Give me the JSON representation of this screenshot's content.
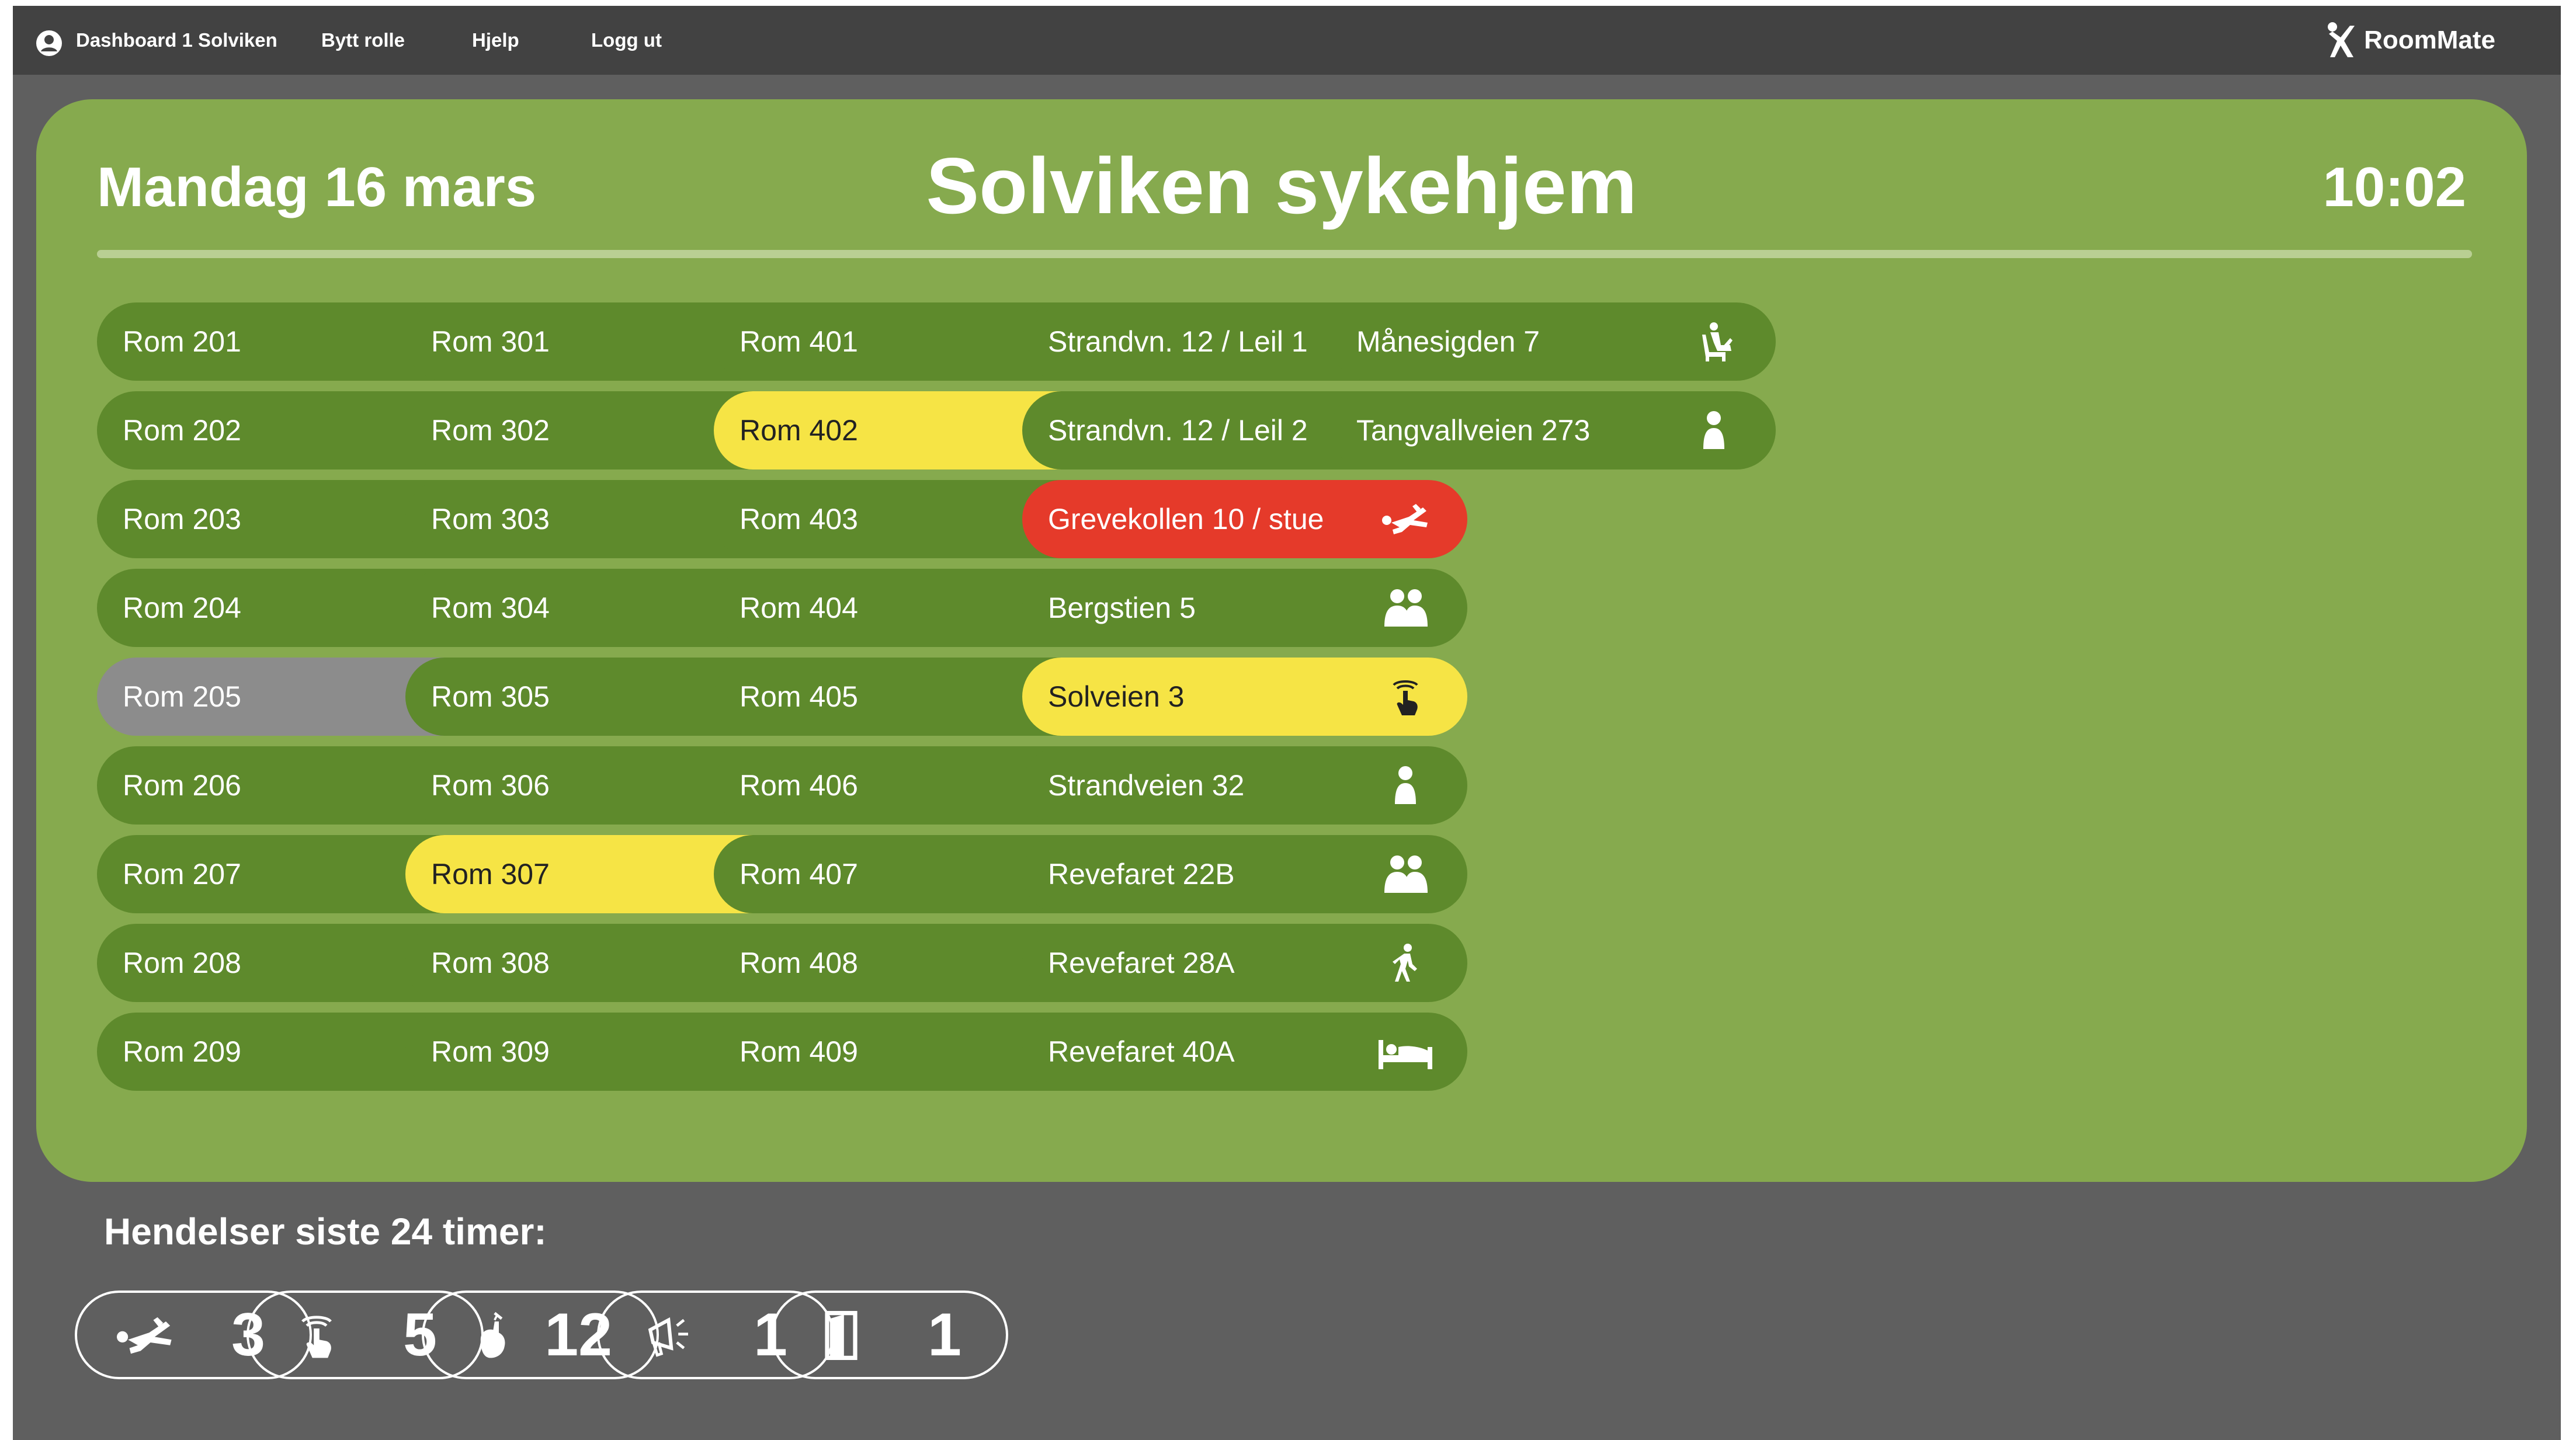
{
  "nav": {
    "user_label": "Dashboard 1 Solviken",
    "switch_role": "Bytt rolle",
    "help": "Hjelp",
    "logout": "Logg ut",
    "brand": "RoomMate"
  },
  "header": {
    "date": "Mandag 16 mars",
    "title": "Solviken sykehjem",
    "time": "10:02"
  },
  "colors": {
    "panel": "#86aa4e",
    "room_default": "#5e8a2c",
    "alert_yellow": "#f6e445",
    "alert_red": "#e53a2a",
    "offline_grey": "#8c8c8c",
    "background": "#5f5f5f",
    "topbar": "#424242"
  },
  "columns": [
    [
      {
        "label": "Rom 201",
        "icon": "person-icon",
        "status": "normal"
      },
      {
        "label": "Rom 202",
        "icon": "bed-icon",
        "status": "normal"
      },
      {
        "label": "Rom 203",
        "icon": "chair-icon",
        "status": "normal"
      },
      {
        "label": "Rom 204",
        "icon": "bed-icon",
        "status": "normal"
      },
      {
        "label": "Rom 205",
        "icon": "unplugged-icon",
        "status": "offline"
      },
      {
        "label": "Rom 206",
        "icon": "person-icon",
        "status": "normal"
      },
      {
        "label": "Rom 207",
        "icon": "person-icon",
        "status": "normal"
      },
      {
        "label": "Rom 208",
        "icon": "two-persons-icon",
        "status": "normal"
      },
      {
        "label": "Rom 209",
        "icon": "bed-icon",
        "status": "normal"
      }
    ],
    [
      {
        "label": "Rom 301",
        "icon": "bed-icon",
        "status": "normal"
      },
      {
        "label": "Rom 302",
        "icon": "bed-icon",
        "status": "normal"
      },
      {
        "label": "Rom 303",
        "icon": "person-icon",
        "status": "normal"
      },
      {
        "label": "Rom 304",
        "icon": "chair-icon",
        "status": "normal"
      },
      {
        "label": "Rom 305",
        "icon": "chair-icon",
        "status": "normal"
      },
      {
        "label": "Rom 306",
        "icon": "bed-icon",
        "status": "normal"
      },
      {
        "label": "Rom 307",
        "icon": "door-exit-icon",
        "status": "alert"
      },
      {
        "label": "Rom 308",
        "icon": "walking-icon",
        "status": "normal"
      },
      {
        "label": "Rom 309",
        "icon": "person-icon",
        "status": "normal"
      }
    ],
    [
      {
        "label": "Rom 401",
        "icon": "person-icon",
        "status": "normal"
      },
      {
        "label": "Rom 402",
        "icon": "toilet-hand-icon",
        "status": "alert"
      },
      {
        "label": "Rom 403",
        "icon": "bed-icon",
        "status": "normal"
      },
      {
        "label": "Rom 404",
        "icon": "bed-icon",
        "status": "normal"
      },
      {
        "label": "Rom 405",
        "icon": "person-icon",
        "status": "normal"
      },
      {
        "label": "Rom 406",
        "icon": "person-icon",
        "status": "normal"
      },
      {
        "label": "Rom 407",
        "icon": "bed-icon",
        "status": "normal"
      },
      {
        "label": "Rom 408",
        "icon": "chair-icon",
        "status": "normal"
      },
      {
        "label": "Rom 409",
        "icon": "bed-icon",
        "status": "normal"
      }
    ],
    [
      {
        "label": "Strandvn. 12 / Leil 1",
        "icon": "chair-icon",
        "status": "normal"
      },
      {
        "label": "Strandvn. 12 / Leil 2",
        "icon": "person-icon",
        "status": "normal"
      },
      {
        "label": "Grevekollen 10 / stue",
        "icon": "fall-icon",
        "status": "critical"
      },
      {
        "label": "Bergstien 5",
        "icon": "two-persons-icon",
        "status": "normal"
      },
      {
        "label": "Solveien 3",
        "icon": "call-button-icon",
        "status": "alert"
      },
      {
        "label": "Strandveien 32",
        "icon": "person-icon",
        "status": "normal"
      },
      {
        "label": "Revefaret 22B",
        "icon": "two-persons-icon",
        "status": "normal"
      },
      {
        "label": "Revefaret 28A",
        "icon": "walking-icon",
        "status": "normal"
      },
      {
        "label": "Revefaret 40A",
        "icon": "bed-icon",
        "status": "normal"
      }
    ],
    [
      {
        "label": "Månesigden 7",
        "icon": "chair-icon",
        "status": "normal"
      },
      {
        "label": "Tangvallveien 273",
        "icon": "person-icon",
        "status": "normal"
      }
    ]
  ],
  "events": {
    "title": "Hendelser siste 24 timer:",
    "items": [
      {
        "icon": "fall-icon",
        "count": "3"
      },
      {
        "icon": "call-button-icon",
        "count": "5"
      },
      {
        "icon": "toilet-hand-icon",
        "count": "12"
      },
      {
        "icon": "megaphone-icon",
        "count": "1"
      },
      {
        "icon": "door-exit-icon",
        "count": "1"
      }
    ]
  }
}
